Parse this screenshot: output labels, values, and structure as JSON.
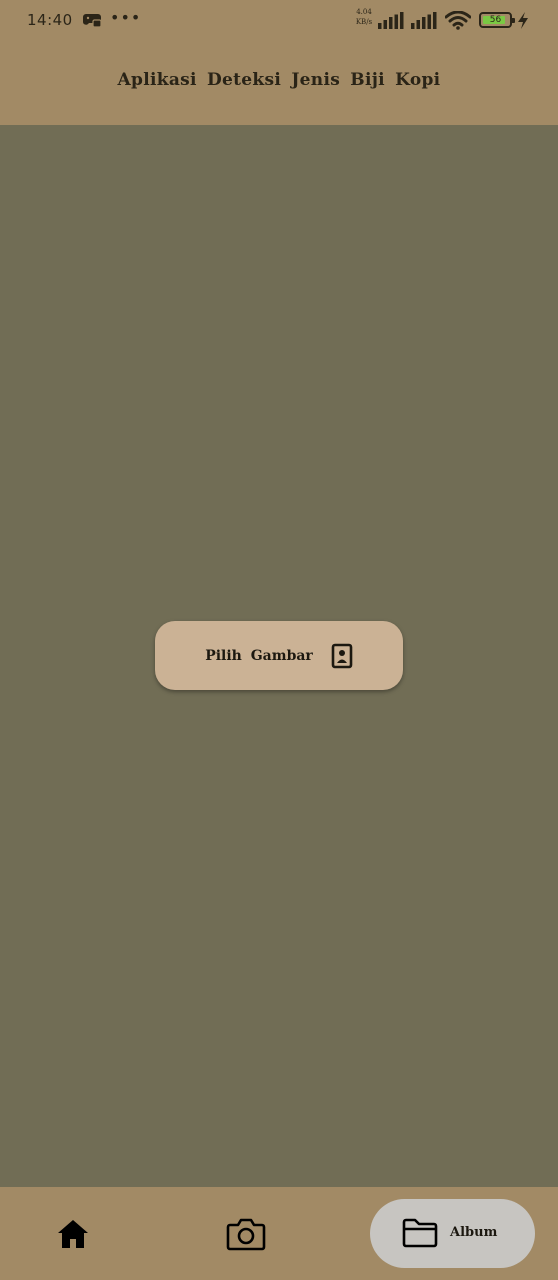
{
  "status_bar": {
    "time": "14:40",
    "more_dots": "•••",
    "speed_value": "4.04",
    "speed_unit": "KB/s",
    "battery_level": "56",
    "icons": [
      "game-controller-icon",
      "signal-icon",
      "signal-icon",
      "wifi-icon",
      "battery-icon",
      "charging-bolt-icon"
    ]
  },
  "header": {
    "title": "Aplikasi Deteksi Jenis Biji Kopi"
  },
  "main": {
    "pick_button": {
      "label": "Pilih Gambar",
      "icon": "portrait-image-icon"
    }
  },
  "bottom_nav": {
    "items": [
      {
        "name": "home",
        "icon": "home-icon",
        "label": ""
      },
      {
        "name": "camera",
        "icon": "camera-icon",
        "label": ""
      },
      {
        "name": "album",
        "icon": "folder-icon",
        "label": "Album",
        "active": true
      }
    ]
  },
  "colors": {
    "header_bg": "#a28a65",
    "body_bg": "#716d55",
    "button_bg": "#cbb295",
    "active_nav_bg": "#c7c5c1",
    "text": "#1c1810",
    "battery_fill": "#7ac943"
  }
}
